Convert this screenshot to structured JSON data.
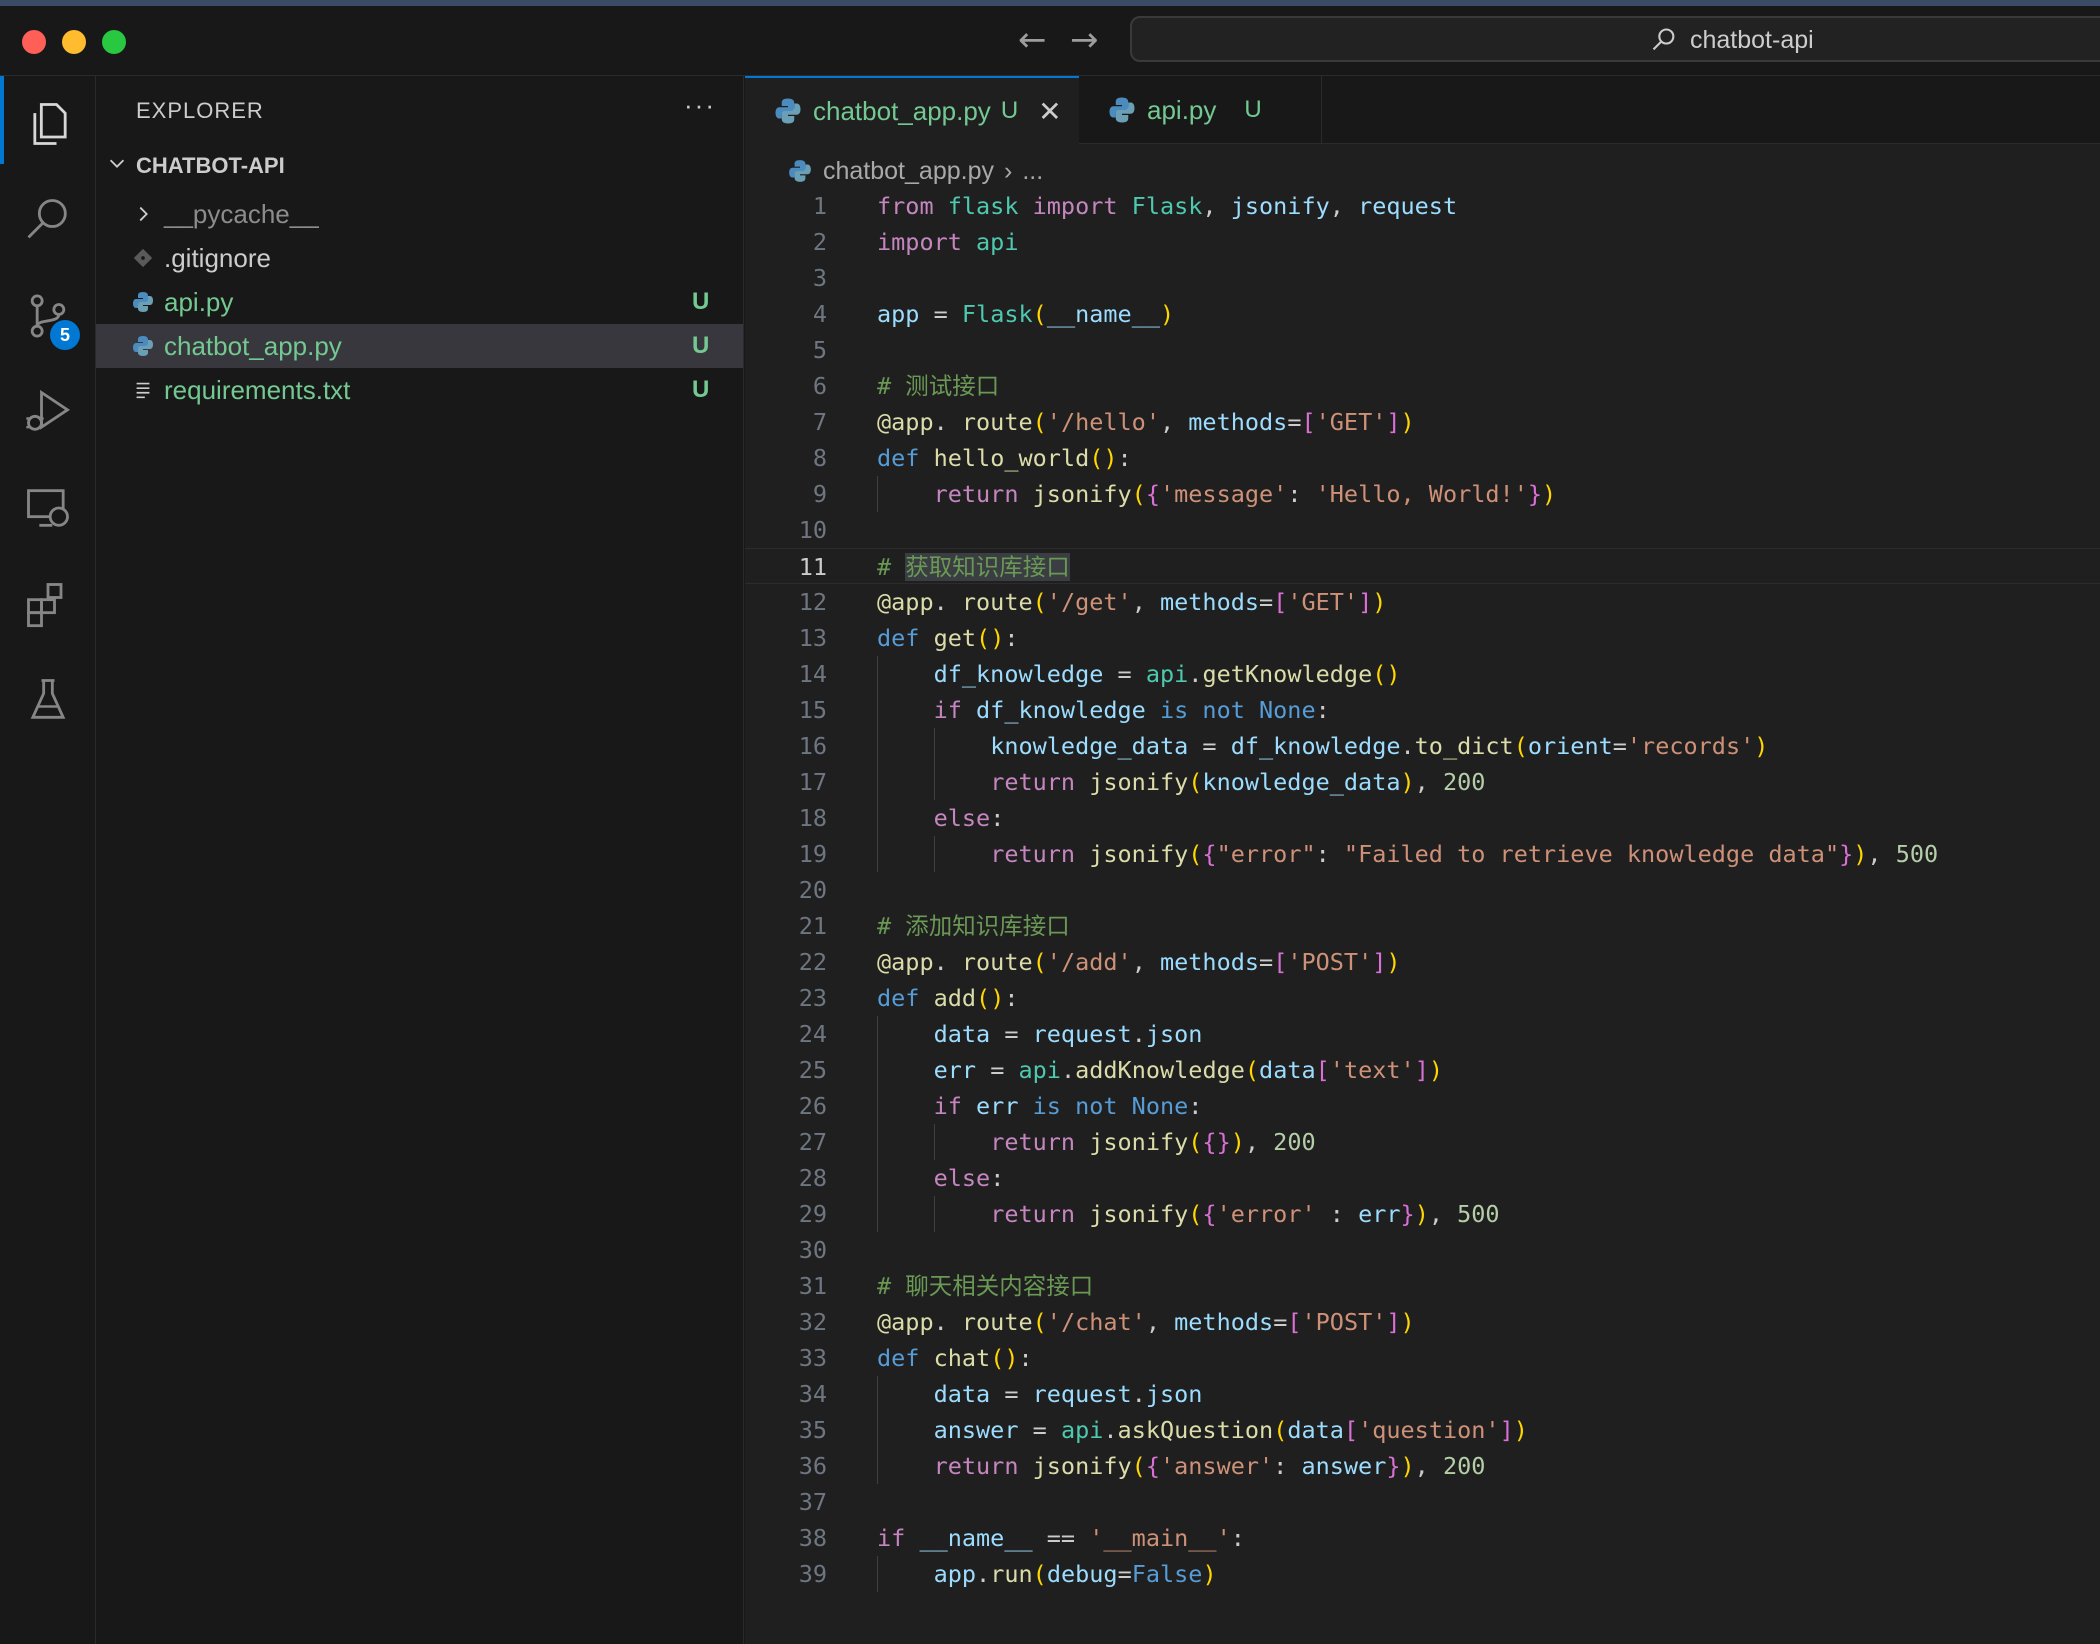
{
  "window": {
    "search_text": "chatbot-api"
  },
  "activity_bar": {
    "source_control_badge": "5"
  },
  "explorer": {
    "title": "EXPLORER",
    "more": "···",
    "root": "CHATBOT-API",
    "items": [
      {
        "name": "__pycache__",
        "status": "",
        "kind": "folder"
      },
      {
        "name": ".gitignore",
        "status": "",
        "kind": "git"
      },
      {
        "name": "api.py",
        "status": "U",
        "kind": "python"
      },
      {
        "name": "chatbot_app.py",
        "status": "U",
        "kind": "python"
      },
      {
        "name": "requirements.txt",
        "status": "U",
        "kind": "text"
      }
    ]
  },
  "tabs": [
    {
      "name": "chatbot_app.py",
      "status": "U",
      "close": "✕"
    },
    {
      "name": "api.py",
      "status": "U"
    }
  ],
  "breadcrumb": {
    "file": "chatbot_app.py",
    "sep": "›",
    "rest": "..."
  },
  "editor": {
    "current_line": 11,
    "lines": [
      {
        "n": 1,
        "t": [
          [
            "kw",
            "from"
          ],
          [
            "",
            ""
          ],
          [
            "mod",
            " flask"
          ],
          [
            "kw",
            " import"
          ],
          [
            "mod",
            " Flask"
          ],
          [
            "",
            ", "
          ],
          [
            "vr",
            "jsonify"
          ],
          [
            "",
            ", "
          ],
          [
            "vr",
            "request"
          ]
        ]
      },
      {
        "n": 2,
        "t": [
          [
            "kw",
            "import"
          ],
          [
            "mod",
            " api"
          ]
        ]
      },
      {
        "n": 3,
        "t": []
      },
      {
        "n": 4,
        "t": [
          [
            "vr",
            "app"
          ],
          [
            "",
            " = "
          ],
          [
            "mod",
            "Flask"
          ],
          [
            "br1",
            "("
          ],
          [
            "vr",
            "__name__"
          ],
          [
            "br1",
            ")"
          ]
        ]
      },
      {
        "n": 5,
        "t": []
      },
      {
        "n": 6,
        "t": [
          [
            "cm",
            "# 测试接口"
          ]
        ]
      },
      {
        "n": 7,
        "t": [
          [
            "fn",
            "@app"
          ],
          [
            "",
            ". "
          ],
          [
            "fn",
            "route"
          ],
          [
            "br1",
            "("
          ],
          [
            "st",
            "'/hello'"
          ],
          [
            "",
            ", "
          ],
          [
            "vr",
            "methods"
          ],
          [
            "",
            "="
          ],
          [
            "br2",
            "["
          ],
          [
            "st",
            "'GET'"
          ],
          [
            "br2",
            "]"
          ],
          [
            "br1",
            ")"
          ]
        ]
      },
      {
        "n": 8,
        "t": [
          [
            "kb",
            "def"
          ],
          [
            "fn",
            " hello_world"
          ],
          [
            "br1",
            "()"
          ],
          [
            "",
            ":"
          ]
        ]
      },
      {
        "n": 9,
        "t": [
          [
            "",
            "    "
          ],
          [
            "kw",
            "return"
          ],
          [
            "fn",
            " jsonify"
          ],
          [
            "br1",
            "("
          ],
          [
            "br2",
            "{"
          ],
          [
            "st",
            "'message'"
          ],
          [
            "",
            ": "
          ],
          [
            "st",
            "'Hello, World!'"
          ],
          [
            "br2",
            "}"
          ],
          [
            "br1",
            ")"
          ]
        ]
      },
      {
        "n": 10,
        "t": []
      },
      {
        "n": 11,
        "t": [
          [
            "cm",
            "# "
          ],
          [
            "cmhl",
            "获取知识库接口"
          ]
        ]
      },
      {
        "n": 12,
        "t": [
          [
            "fn",
            "@app"
          ],
          [
            "",
            ". "
          ],
          [
            "fn",
            "route"
          ],
          [
            "br1",
            "("
          ],
          [
            "st",
            "'/get'"
          ],
          [
            "",
            ", "
          ],
          [
            "vr",
            "methods"
          ],
          [
            "",
            "="
          ],
          [
            "br2",
            "["
          ],
          [
            "st",
            "'GET'"
          ],
          [
            "br2",
            "]"
          ],
          [
            "br1",
            ")"
          ]
        ]
      },
      {
        "n": 13,
        "t": [
          [
            "kb",
            "def"
          ],
          [
            "fn",
            " get"
          ],
          [
            "br1",
            "()"
          ],
          [
            "",
            ":"
          ]
        ]
      },
      {
        "n": 14,
        "t": [
          [
            "",
            "    "
          ],
          [
            "vr",
            "df_knowledge"
          ],
          [
            "",
            " = "
          ],
          [
            "mod",
            "api"
          ],
          [
            "",
            "."
          ],
          [
            "fn",
            "getKnowledge"
          ],
          [
            "br1",
            "()"
          ]
        ]
      },
      {
        "n": 15,
        "t": [
          [
            "",
            "    "
          ],
          [
            "kw",
            "if"
          ],
          [
            "vr",
            " df_knowledge"
          ],
          [
            "kb",
            " is not None"
          ],
          [
            "",
            ":"
          ]
        ]
      },
      {
        "n": 16,
        "t": [
          [
            "",
            "        "
          ],
          [
            "vr",
            "knowledge_data"
          ],
          [
            "",
            " = "
          ],
          [
            "vr",
            "df_knowledge"
          ],
          [
            "",
            "."
          ],
          [
            "fn",
            "to_dict"
          ],
          [
            "br1",
            "("
          ],
          [
            "vr",
            "orient"
          ],
          [
            "",
            "="
          ],
          [
            "st",
            "'records'"
          ],
          [
            "br1",
            ")"
          ]
        ]
      },
      {
        "n": 17,
        "t": [
          [
            "",
            "        "
          ],
          [
            "kw",
            "return"
          ],
          [
            "fn",
            " jsonify"
          ],
          [
            "br1",
            "("
          ],
          [
            "vr",
            "knowledge_data"
          ],
          [
            "br1",
            ")"
          ],
          [
            "",
            ", "
          ],
          [
            "nm",
            "200"
          ]
        ]
      },
      {
        "n": 18,
        "t": [
          [
            "",
            "    "
          ],
          [
            "kw",
            "else"
          ],
          [
            "",
            ":"
          ]
        ]
      },
      {
        "n": 19,
        "t": [
          [
            "",
            "        "
          ],
          [
            "kw",
            "return"
          ],
          [
            "fn",
            " jsonify"
          ],
          [
            "br1",
            "("
          ],
          [
            "br2",
            "{"
          ],
          [
            "st",
            "\"error\""
          ],
          [
            "",
            ": "
          ],
          [
            "st",
            "\"Failed to retrieve knowledge data\""
          ],
          [
            "br2",
            "}"
          ],
          [
            "br1",
            ")"
          ],
          [
            "",
            ", "
          ],
          [
            "nm",
            "500"
          ]
        ]
      },
      {
        "n": 20,
        "t": []
      },
      {
        "n": 21,
        "t": [
          [
            "cm",
            "# 添加知识库接口"
          ]
        ]
      },
      {
        "n": 22,
        "t": [
          [
            "fn",
            "@app"
          ],
          [
            "",
            ". "
          ],
          [
            "fn",
            "route"
          ],
          [
            "br1",
            "("
          ],
          [
            "st",
            "'/add'"
          ],
          [
            "",
            ", "
          ],
          [
            "vr",
            "methods"
          ],
          [
            "",
            "="
          ],
          [
            "br2",
            "["
          ],
          [
            "st",
            "'POST'"
          ],
          [
            "br2",
            "]"
          ],
          [
            "br1",
            ")"
          ]
        ]
      },
      {
        "n": 23,
        "t": [
          [
            "kb",
            "def"
          ],
          [
            "fn",
            " add"
          ],
          [
            "br1",
            "()"
          ],
          [
            "",
            ":"
          ]
        ]
      },
      {
        "n": 24,
        "t": [
          [
            "",
            "    "
          ],
          [
            "vr",
            "data"
          ],
          [
            "",
            " = "
          ],
          [
            "vr",
            "request"
          ],
          [
            "",
            "."
          ],
          [
            "vr",
            "json"
          ]
        ]
      },
      {
        "n": 25,
        "t": [
          [
            "",
            "    "
          ],
          [
            "vr",
            "err"
          ],
          [
            "",
            " = "
          ],
          [
            "mod",
            "api"
          ],
          [
            "",
            "."
          ],
          [
            "fn",
            "addKnowledge"
          ],
          [
            "br1",
            "("
          ],
          [
            "vr",
            "data"
          ],
          [
            "br2",
            "["
          ],
          [
            "st",
            "'text'"
          ],
          [
            "br2",
            "]"
          ],
          [
            "br1",
            ")"
          ]
        ]
      },
      {
        "n": 26,
        "t": [
          [
            "",
            "    "
          ],
          [
            "kw",
            "if"
          ],
          [
            "vr",
            " err"
          ],
          [
            "kb",
            " is not None"
          ],
          [
            "",
            ":"
          ]
        ]
      },
      {
        "n": 27,
        "t": [
          [
            "",
            "        "
          ],
          [
            "kw",
            "return"
          ],
          [
            "fn",
            " jsonify"
          ],
          [
            "br1",
            "("
          ],
          [
            "br2",
            "{}"
          ],
          [
            "br1",
            ")"
          ],
          [
            "",
            ", "
          ],
          [
            "nm",
            "200"
          ]
        ]
      },
      {
        "n": 28,
        "t": [
          [
            "",
            "    "
          ],
          [
            "kw",
            "else"
          ],
          [
            "",
            ":"
          ]
        ]
      },
      {
        "n": 29,
        "t": [
          [
            "",
            "        "
          ],
          [
            "kw",
            "return"
          ],
          [
            "fn",
            " jsonify"
          ],
          [
            "br1",
            "("
          ],
          [
            "br2",
            "{"
          ],
          [
            "st",
            "'error'"
          ],
          [
            "",
            " : "
          ],
          [
            "vr",
            "err"
          ],
          [
            "br2",
            "}"
          ],
          [
            "br1",
            ")"
          ],
          [
            "",
            ", "
          ],
          [
            "nm",
            "500"
          ]
        ]
      },
      {
        "n": 30,
        "t": []
      },
      {
        "n": 31,
        "t": [
          [
            "cm",
            "# 聊天相关内容接口"
          ]
        ]
      },
      {
        "n": 32,
        "t": [
          [
            "fn",
            "@app"
          ],
          [
            "",
            ". "
          ],
          [
            "fn",
            "route"
          ],
          [
            "br1",
            "("
          ],
          [
            "st",
            "'/chat'"
          ],
          [
            "",
            ", "
          ],
          [
            "vr",
            "methods"
          ],
          [
            "",
            "="
          ],
          [
            "br2",
            "["
          ],
          [
            "st",
            "'POST'"
          ],
          [
            "br2",
            "]"
          ],
          [
            "br1",
            ")"
          ]
        ]
      },
      {
        "n": 33,
        "t": [
          [
            "kb",
            "def"
          ],
          [
            "fn",
            " chat"
          ],
          [
            "br1",
            "()"
          ],
          [
            "",
            ":"
          ]
        ]
      },
      {
        "n": 34,
        "t": [
          [
            "",
            "    "
          ],
          [
            "vr",
            "data"
          ],
          [
            "",
            " = "
          ],
          [
            "vr",
            "request"
          ],
          [
            "",
            "."
          ],
          [
            "vr",
            "json"
          ]
        ]
      },
      {
        "n": 35,
        "t": [
          [
            "",
            "    "
          ],
          [
            "vr",
            "answer"
          ],
          [
            "",
            " = "
          ],
          [
            "mod",
            "api"
          ],
          [
            "",
            "."
          ],
          [
            "fn",
            "askQuestion"
          ],
          [
            "br1",
            "("
          ],
          [
            "vr",
            "data"
          ],
          [
            "br2",
            "["
          ],
          [
            "st",
            "'question'"
          ],
          [
            "br2",
            "]"
          ],
          [
            "br1",
            ")"
          ]
        ]
      },
      {
        "n": 36,
        "t": [
          [
            "",
            "    "
          ],
          [
            "kw",
            "return"
          ],
          [
            "fn",
            " jsonify"
          ],
          [
            "br1",
            "("
          ],
          [
            "br2",
            "{"
          ],
          [
            "st",
            "'answer'"
          ],
          [
            "",
            ": "
          ],
          [
            "vr",
            "answer"
          ],
          [
            "br2",
            "}"
          ],
          [
            "br1",
            ")"
          ],
          [
            "",
            ", "
          ],
          [
            "nm",
            "200"
          ]
        ]
      },
      {
        "n": 37,
        "t": []
      },
      {
        "n": 38,
        "t": [
          [
            "kw",
            "if"
          ],
          [
            "vr",
            " __name__"
          ],
          [
            "",
            " == "
          ],
          [
            "st",
            "'__main__'"
          ],
          [
            "",
            ":"
          ]
        ]
      },
      {
        "n": 39,
        "t": [
          [
            "",
            "    "
          ],
          [
            "vr",
            "app"
          ],
          [
            "",
            "."
          ],
          [
            "fn",
            "run"
          ],
          [
            "br1",
            "("
          ],
          [
            "vr",
            "debug"
          ],
          [
            "",
            "="
          ],
          [
            "kb",
            "False"
          ],
          [
            "br1",
            ")"
          ]
        ]
      }
    ]
  }
}
